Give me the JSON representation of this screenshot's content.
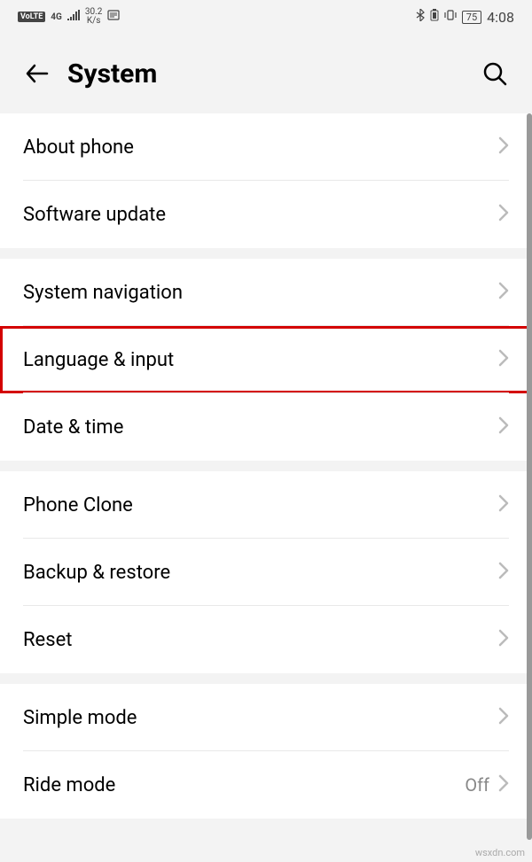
{
  "statusBar": {
    "volte": "VoLTE",
    "network": "4G",
    "speed_value": "30.2",
    "speed_unit": "K/s",
    "battery": "75",
    "time": "4:08"
  },
  "header": {
    "title": "System"
  },
  "sections": [
    {
      "items": [
        {
          "id": "about-phone",
          "label": "About phone",
          "value": ""
        },
        {
          "id": "software-update",
          "label": "Software update",
          "value": ""
        }
      ]
    },
    {
      "items": [
        {
          "id": "system-navigation",
          "label": "System navigation",
          "value": ""
        },
        {
          "id": "language-input",
          "label": "Language & input",
          "value": "",
          "highlighted": true
        },
        {
          "id": "date-time",
          "label": "Date & time",
          "value": ""
        }
      ]
    },
    {
      "items": [
        {
          "id": "phone-clone",
          "label": "Phone Clone",
          "value": ""
        },
        {
          "id": "backup-restore",
          "label": "Backup & restore",
          "value": ""
        },
        {
          "id": "reset",
          "label": "Reset",
          "value": ""
        }
      ]
    },
    {
      "items": [
        {
          "id": "simple-mode",
          "label": "Simple mode",
          "value": ""
        },
        {
          "id": "ride-mode",
          "label": "Ride mode",
          "value": "Off"
        }
      ]
    }
  ],
  "watermark": "wsxdn.com"
}
